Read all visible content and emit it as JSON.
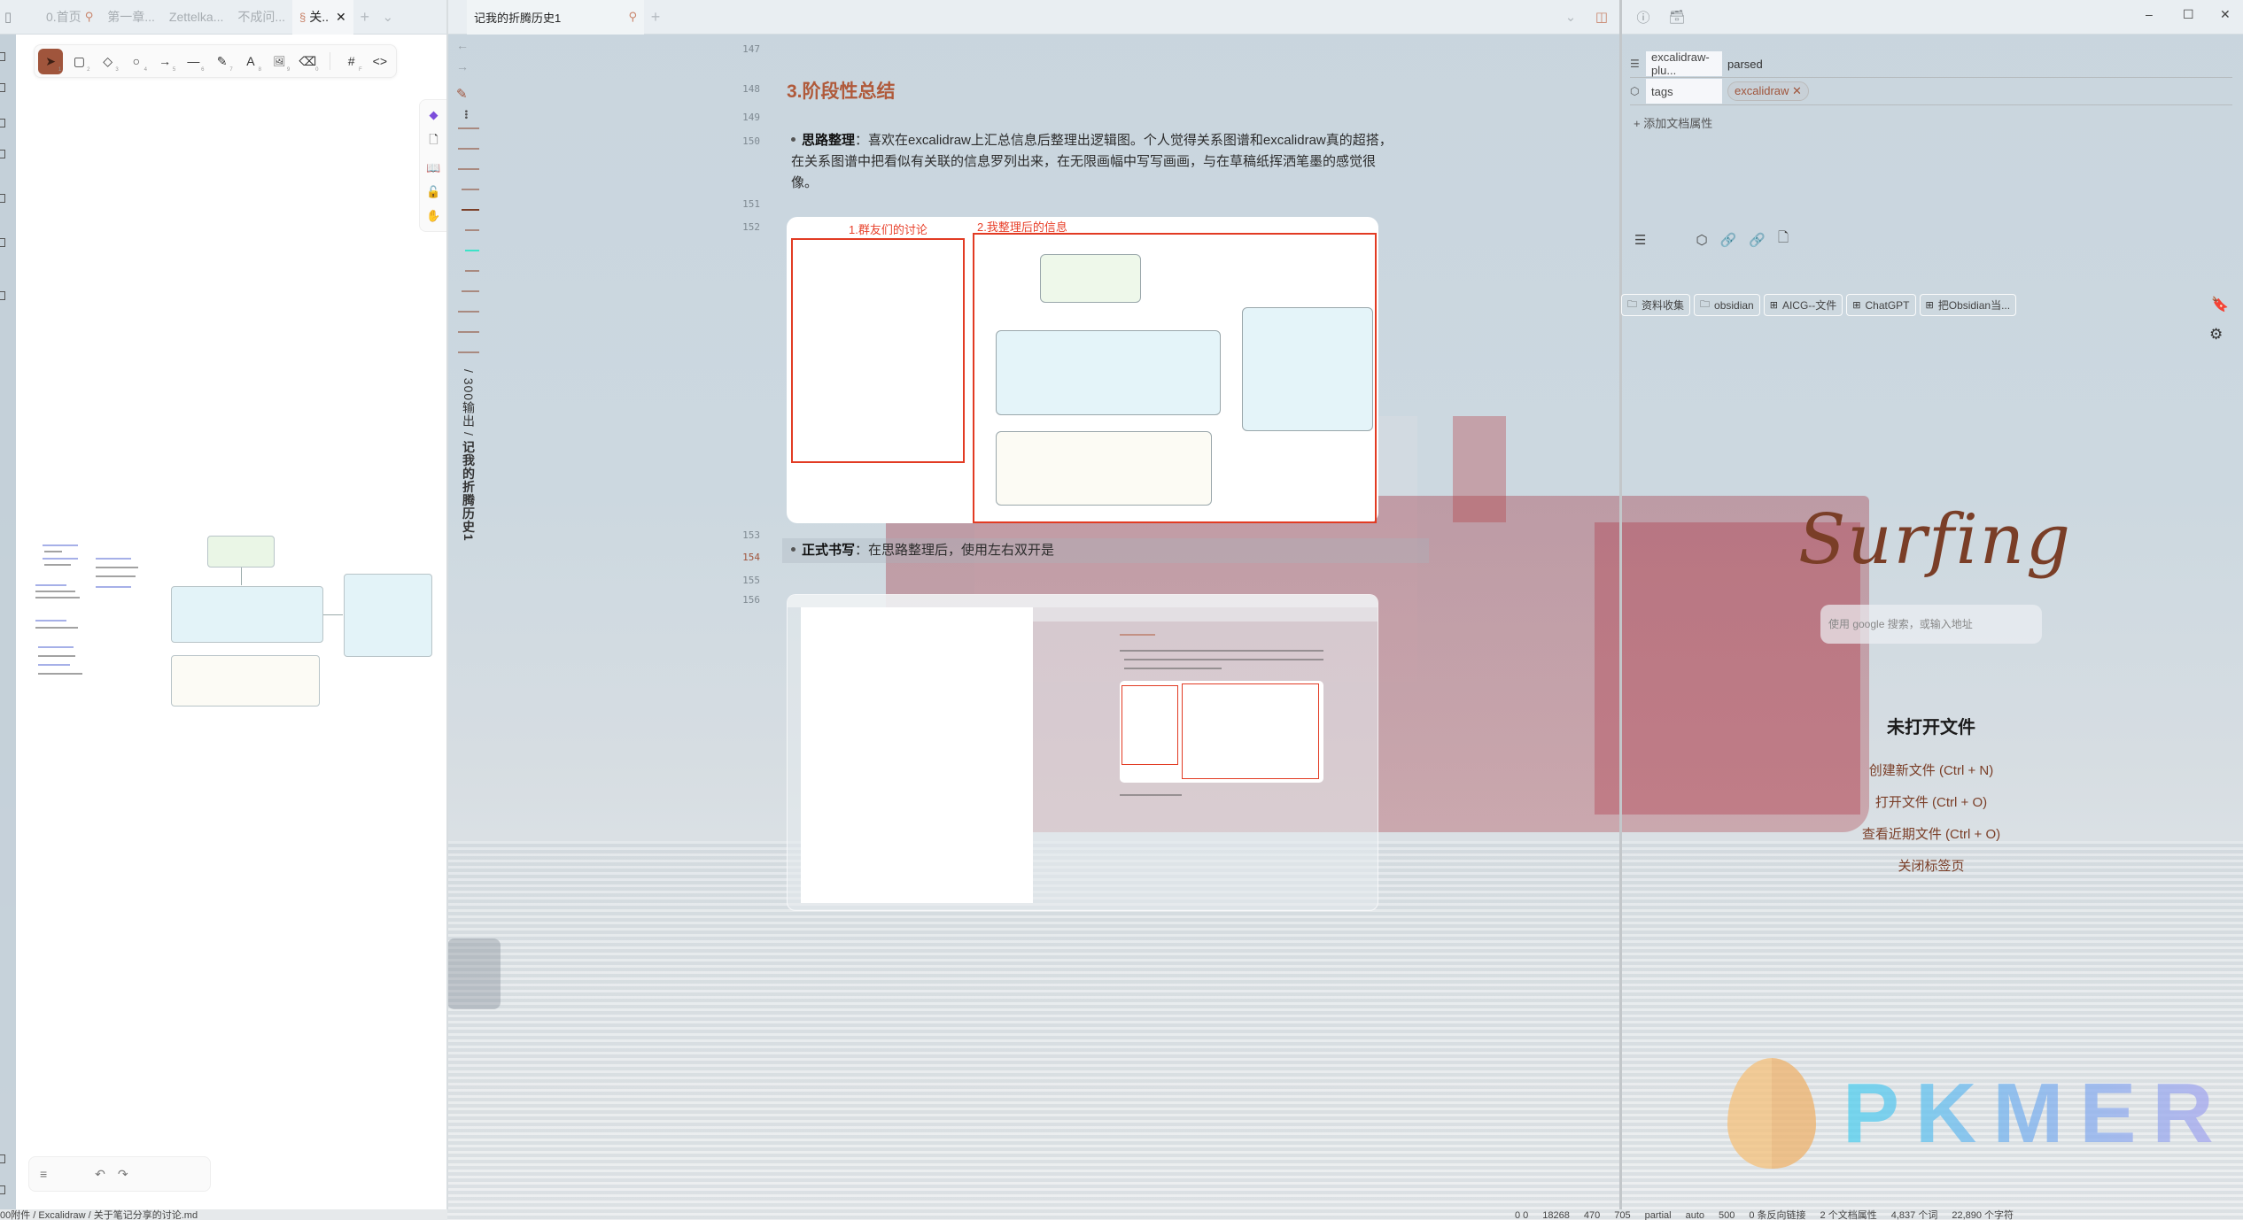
{
  "left_pane": {
    "tabs": [
      {
        "label": "0.首页",
        "pinned": true,
        "active": false
      },
      {
        "label": "第一章...",
        "pinned": false,
        "active": false
      },
      {
        "label": "Zettelka...",
        "pinned": false,
        "active": false
      },
      {
        "label": "不成问...",
        "pinned": false,
        "active": false
      },
      {
        "label": "关..",
        "pinned": false,
        "active": true
      }
    ],
    "new_tab_icon": "+",
    "tab_list_icon": "⌄",
    "excalidraw_toolbar": [
      {
        "name": "selection",
        "glyph": "➤",
        "key": "1",
        "selected": true
      },
      {
        "name": "rectangle",
        "glyph": "▢",
        "key": "2"
      },
      {
        "name": "diamond",
        "glyph": "◇",
        "key": "3"
      },
      {
        "name": "ellipse",
        "glyph": "○",
        "key": "4"
      },
      {
        "name": "arrow",
        "glyph": "→",
        "key": "5"
      },
      {
        "name": "line",
        "glyph": "—",
        "key": "6"
      },
      {
        "name": "draw",
        "glyph": "✎",
        "key": "7"
      },
      {
        "name": "text",
        "glyph": "A",
        "key": "8"
      },
      {
        "name": "image",
        "glyph": "🖼",
        "key": "9"
      },
      {
        "name": "eraser",
        "glyph": "⌫",
        "key": "0"
      },
      {
        "name": "frame",
        "glyph": "#",
        "key": "F"
      },
      {
        "name": "embed",
        "glyph": "<>",
        "key": ""
      }
    ],
    "side_tools": [
      "obsidian",
      "new-file",
      "book",
      "lock",
      "hand"
    ],
    "footer": {
      "menu": "≡",
      "undo": "↶",
      "redo": "↷"
    }
  },
  "middle_pane": {
    "tab": {
      "label": "记我的折腾历史1",
      "pinned": true
    },
    "new_tab_icon": "+",
    "vertical_breadcrumb": "/ 300输出 / 记我的折腾历史1",
    "vertical_breadcrumb_folder": "/ 300输出 /",
    "vertical_breadcrumb_file": "记我的折腾历史1",
    "lines": [
      {
        "num": "147",
        "text": ""
      },
      {
        "num": "148",
        "text": "3.阶段性总结"
      },
      {
        "num": "149",
        "text": ""
      },
      {
        "num": "150",
        "bold": "思路整理",
        "text": "：喜欢在excalidraw上汇总信息后整理出逻辑图。个人觉得关系图谱和excalidraw真的超搭，在关系图谱中把看似有关联的信息罗列出来，在无限画幅中写写画画，与在草稿纸挥洒笔墨的感觉很像。"
      },
      {
        "num": "151",
        "text": ""
      },
      {
        "num": "152",
        "text": "[embedded excalidraw image]"
      },
      {
        "num": "153",
        "text": ""
      },
      {
        "num": "154",
        "bold": "正式书写",
        "text": "：在思路整理后，使用左右双开是",
        "active": true
      },
      {
        "num": "155",
        "text": ""
      },
      {
        "num": "156",
        "text": "[embedded screenshot]"
      }
    ],
    "embed1": {
      "title1": "1.群友们的讨论",
      "title2": "2.我整理后的信息"
    }
  },
  "right_pane": {
    "properties": [
      {
        "icon": "list-icon",
        "key": "excalidraw-plu...",
        "value": "parsed"
      },
      {
        "icon": "tag-icon",
        "key": "tags",
        "tags": [
          "excalidraw"
        ]
      }
    ],
    "add_property": "添加文档属性",
    "bookmarks": [
      {
        "icon": "folder",
        "label": "资料收集"
      },
      {
        "icon": "folder",
        "label": "obsidian"
      },
      {
        "icon": "bookmark",
        "label": "AICG--文件"
      },
      {
        "icon": "bookmark",
        "label": "ChatGPT"
      },
      {
        "icon": "bookmark",
        "label": "把Obsidian当..."
      }
    ],
    "logo": "Surfing",
    "search_placeholder": "使用 google 搜索，或输入地址",
    "empty_title": "未打开文件",
    "actions": [
      "创建新文件 (Ctrl + N)",
      "打开文件 (Ctrl + O)",
      "查看近期文件 (Ctrl + O)",
      "关闭标签页"
    ],
    "watermark": "PKMER"
  },
  "status_bar": {
    "left_path": "00附件 / Excalidraw / 关于笔记分享的讨论.md",
    "right_items": [
      "0 0",
      "18268",
      "470",
      "705",
      "partial",
      "auto",
      "500",
      "0 条反向链接",
      "2 个文档属性",
      "4,837 个词",
      "22,890 个字符"
    ]
  },
  "colors": {
    "accent": "#a0553c",
    "heading": "#b05a3a",
    "frame_red": "#e23b23",
    "bookmark_red": "#e44b5a"
  }
}
